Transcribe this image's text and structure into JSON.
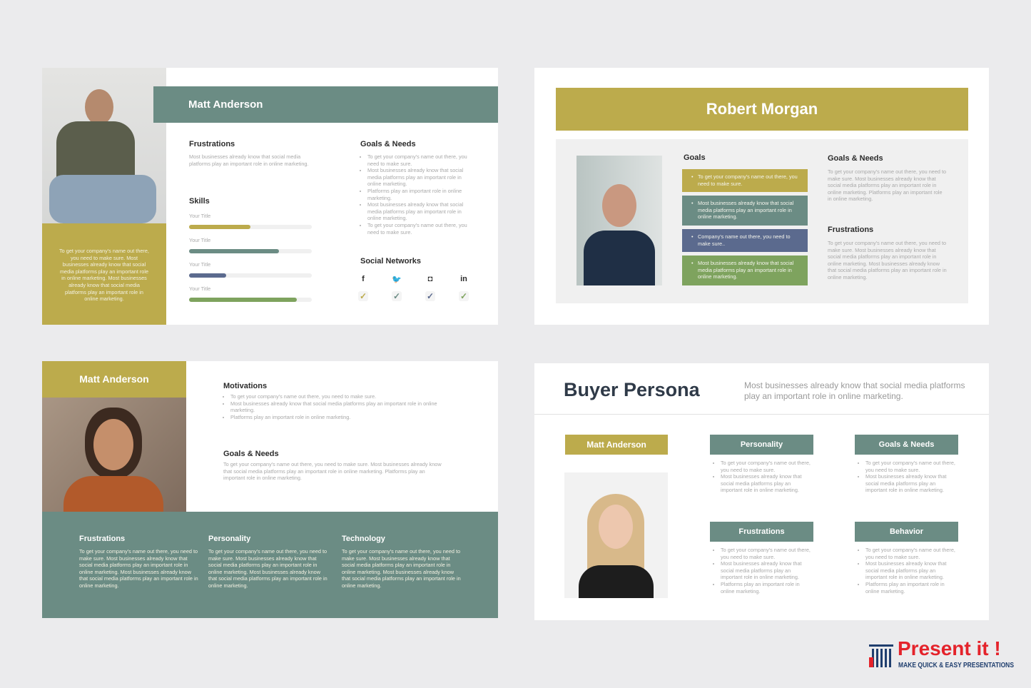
{
  "colors": {
    "olive": "#bcab4c",
    "teal": "#6b8c84",
    "navy": "#5b6a8e",
    "green": "#7ea35e",
    "background": "#ebebed"
  },
  "slide1": {
    "name": "Matt Anderson",
    "side_text": "To get your company's name out there, you need to make sure. Most businesses already know that social media platforms play an important role in online marketing. Most businesses already know that social media platforms play an important role in online marketing.",
    "frustrations": {
      "title": "Frustrations",
      "text": "Most businesses already know that social media platforms play an important role in online marketing."
    },
    "skills": {
      "title": "Skills",
      "items": [
        {
          "label": "Your Title",
          "percent": 50
        },
        {
          "label": "Your Title",
          "percent": 73
        },
        {
          "label": "Your Title",
          "percent": 30
        },
        {
          "label": "Your Title",
          "percent": 88
        }
      ]
    },
    "goals": {
      "title": "Goals & Needs",
      "items": [
        "To get your company's name out there, you need to make sure.",
        "Most businesses already know that social media platforms play an important role in online marketing.",
        "Platforms play an important role in online marketing.",
        "Most businesses already know that social media platforms play an important role in online marketing.",
        "To get your company's name out there, you need to make sure."
      ]
    },
    "social": {
      "title": "Social Networks",
      "icons": [
        "facebook-icon",
        "twitter-icon",
        "instagram-icon",
        "linkedin-icon"
      ],
      "glyphs": [
        "f",
        "🐦",
        "◘",
        "in"
      ],
      "check": "✓"
    }
  },
  "slide2": {
    "name": "Robert Morgan",
    "goals": {
      "title": "Goals",
      "items": [
        "To get your company's name out there, you need to make sure.",
        "Most businesses already know that social media platforms play an important role in online marketing.",
        "Company's name out there, you need to make sure..",
        "Most businesses already know that social media platforms play an important role in online marketing."
      ]
    },
    "goals_needs": {
      "title": "Goals & Needs",
      "text": "To get your company's name out there, you need to make sure. Most businesses already know that social media platforms play an important role in online marketing. Platforms play an important role in online marketing."
    },
    "frustrations": {
      "title": "Frustrations",
      "text": "To get your company's name out there, you need to make sure. Most businesses already know that social media platforms play an important role in online marketing. Most businesses already know that social media platforms play an important role in online marketing."
    }
  },
  "slide3": {
    "name": "Matt Anderson",
    "motivations": {
      "title": "Motivations",
      "items": [
        "To get your company's name out there, you need to make sure.",
        "Most businesses already know that social media platforms play an important role in online marketing.",
        "Platforms play an important role in online marketing."
      ]
    },
    "goals": {
      "title": "Goals & Needs",
      "text": "To get your company's name out there, you need to make sure. Most businesses already know that social media platforms play an important role in online marketing.  Platforms play an important role in online marketing."
    },
    "columns": [
      {
        "title": "Frustrations",
        "text": "To get your company's name out there, you need to make sure. Most businesses already know that social media platforms play an important role in online marketing. Most businesses already know that social media platforms play an important role in online marketing."
      },
      {
        "title": "Personality",
        "text": "To get your company's name out there, you need to make sure. Most businesses already know that social media platforms play an important role in online marketing. Most businesses already know that social media platforms play an important role in online marketing."
      },
      {
        "title": "Technology",
        "text": "To get your company's name out there, you need to make sure. Most businesses already know that social media platforms play an important role in online marketing. Most businesses already know that social media platforms play an important role in online marketing."
      }
    ]
  },
  "slide4": {
    "title": "Buyer Persona",
    "subtitle": "Most businesses already know that social media platforms play an important role in online marketing.",
    "name": "Matt Anderson",
    "cards": [
      {
        "title": "Personality",
        "items": [
          "To get your company's name out there, you need to make sure.",
          "Most businesses already know that social media platforms play an important role in online marketing."
        ]
      },
      {
        "title": "Goals & Needs",
        "items": [
          "To get your company's name out there, you need to make sure.",
          "Most businesses already know that social media platforms play an important role in online marketing."
        ]
      },
      {
        "title": "Frustrations",
        "items": [
          "To get your company's name out there, you need to make sure.",
          "Most businesses already know that social media platforms play an important role in online marketing.",
          "Platforms play an important role in online marketing."
        ]
      },
      {
        "title": "Behavior",
        "items": [
          "To get your company's name out there, you need to make sure.",
          "Most businesses already know that social media platforms play an important role in online marketing.",
          "Platforms play an important role in online marketing."
        ]
      }
    ]
  },
  "logo": {
    "name": "Present it !",
    "tagline": "MAKE QUICK & EASY PRESENTATIONS"
  }
}
